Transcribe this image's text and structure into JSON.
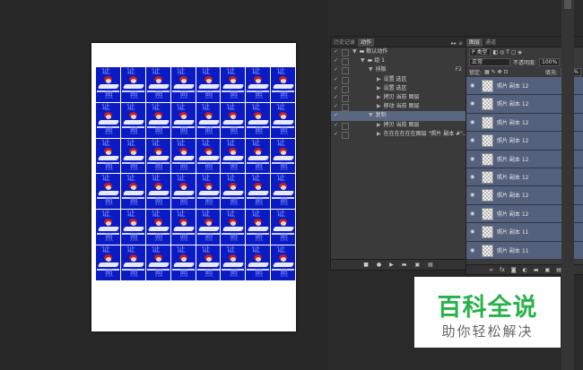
{
  "photo_watermark": {
    "char1": "证",
    "char2": "照"
  },
  "colors": {
    "photo_bg": "#0b1bc4",
    "selected_row": "#5a6780",
    "layer_row": "#53617c",
    "brand_green": "#28b24a"
  },
  "actions_panel": {
    "tabs": [
      "历史记录",
      "动作"
    ],
    "rows": [
      {
        "label": "默认动作",
        "indent": 0,
        "expanded": true,
        "type": "folder"
      },
      {
        "label": "组 1",
        "indent": 1,
        "expanded": true,
        "type": "folder"
      },
      {
        "label": "排版",
        "indent": 2,
        "expanded": true,
        "key": "F2"
      },
      {
        "label": "设置 选区",
        "indent": 3
      },
      {
        "label": "设置 选区",
        "indent": 3
      },
      {
        "label": "拷贝 当前 图层",
        "indent": 3
      },
      {
        "label": "移动 当前 图层",
        "indent": 3
      },
      {
        "label": "复制",
        "indent": 2,
        "expanded": true,
        "selected": true
      },
      {
        "label": "拷贝 当前 图层",
        "indent": 3
      },
      {
        "label": "在在在在在在图层 \"照片 副本 #\"...",
        "indent": 3
      }
    ],
    "bottom_icons": [
      "stop-icon",
      "record-icon",
      "play-icon",
      "new-set-icon",
      "new-action-icon",
      "delete-icon"
    ]
  },
  "layers_panel": {
    "tabs": [
      "图层",
      "通道"
    ],
    "filter_label": "P 类型",
    "blend_mode": "正常",
    "opacity_label": "不透明度:",
    "opacity_value": "100%",
    "lock_label": "锁定:",
    "fill_label": "填充:",
    "fill_value": "100%",
    "layers": [
      "照片 副本 12",
      "照片 副本 12",
      "照片 副本 12",
      "照片 副本 12",
      "照片 副本 12",
      "照片 副本 12",
      "照片 副本 12",
      "照片 副本 12",
      "照片 副本 11",
      "照片 副本 11"
    ],
    "bottom_icons": [
      "link-icon",
      "fx-icon",
      "mask-icon",
      "adjustment-icon",
      "folder-icon",
      "new-layer-icon",
      "trash-icon"
    ]
  },
  "brand": {
    "main": "百科全说",
    "sub": "助你轻松解决"
  }
}
